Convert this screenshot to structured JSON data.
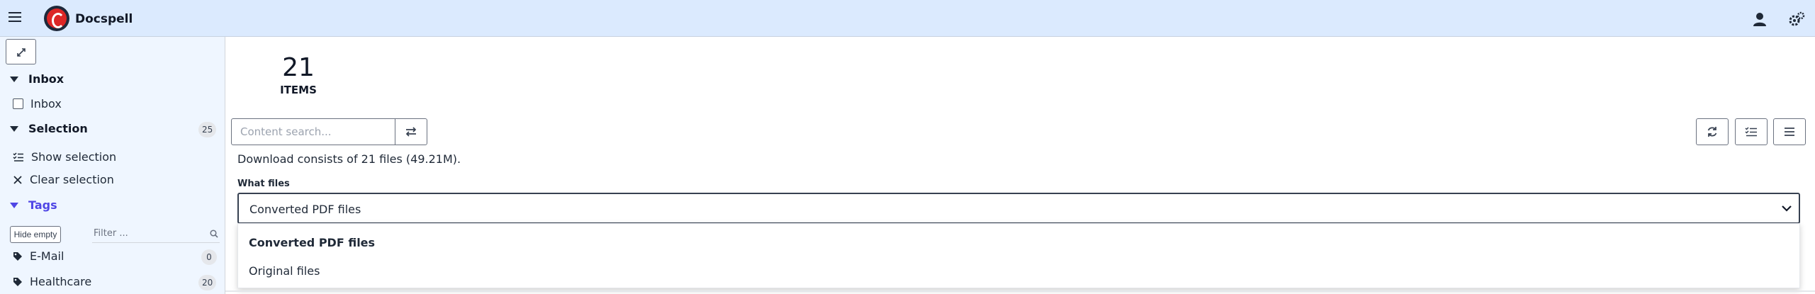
{
  "app": {
    "title": "Docspell"
  },
  "sidebar": {
    "sections": {
      "inbox": {
        "label": "Inbox",
        "items": [
          {
            "label": "Inbox"
          }
        ]
      },
      "selection": {
        "label": "Selection",
        "count": "25",
        "items": [
          {
            "label": "Show selection",
            "icon": "list-check-icon"
          },
          {
            "label": "Clear selection",
            "icon": "close-icon"
          }
        ]
      },
      "tags": {
        "label": "Tags",
        "hide_empty_label": "Hide empty",
        "filter_placeholder": "Filter ...",
        "items": [
          {
            "label": "E-Mail",
            "count": "0"
          },
          {
            "label": "Healthcare",
            "count": "20"
          }
        ]
      }
    }
  },
  "main": {
    "count": "21",
    "count_label": "ITEMS",
    "search": {
      "placeholder": "Content search..."
    },
    "download_info": "Download consists of 21 files (49.21M).",
    "what_files": {
      "label": "What files",
      "selected": "Converted PDF files",
      "options": [
        "Converted PDF files",
        "Original files"
      ]
    }
  },
  "colors": {
    "topbar": "#dbeafe",
    "sidebar": "#eff6ff",
    "accent": "#4f46e5",
    "primary_button": "#2563eb"
  }
}
